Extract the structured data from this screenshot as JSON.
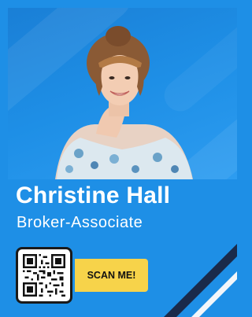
{
  "card": {
    "name": "Christine Hall",
    "title": "Broker-Associate",
    "cta_label": "SCAN ME!",
    "qr_icon": "qr-code-icon",
    "photo_icon": "agent-portrait-photo"
  },
  "colors": {
    "background": "#1e8fe6",
    "cta": "#f7d34a",
    "text": "#ffffff",
    "accent_dark": "#1a2a4a"
  }
}
